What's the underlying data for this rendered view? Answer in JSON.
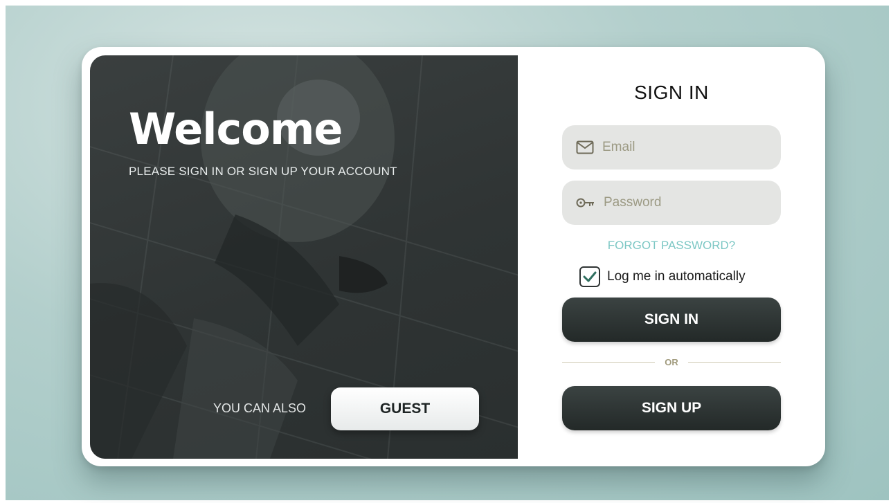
{
  "hero": {
    "title": "Welcome",
    "subtitle": "PLEASE SIGN IN OR SIGN UP YOUR ACCOUNT",
    "also_text": "YOU CAN ALSO",
    "guest_label": "GUEST"
  },
  "form": {
    "title": "SIGN IN",
    "email": {
      "placeholder": "Email",
      "value": "",
      "icon": "envelope-icon"
    },
    "password": {
      "placeholder": "Password",
      "value": "",
      "icon": "key-icon"
    },
    "forgot_label": "FORGOT PASSWORD?",
    "remember": {
      "label": "Log me in automatically",
      "checked": true
    },
    "sign_in_label": "SIGN IN",
    "divider_label": "OR",
    "sign_up_label": "SIGN UP"
  },
  "colors": {
    "accent_link": "#7cc7c4",
    "button_dark": "#2a302f",
    "field_bg": "#e4e5e3",
    "placeholder": "#9c9a84"
  }
}
